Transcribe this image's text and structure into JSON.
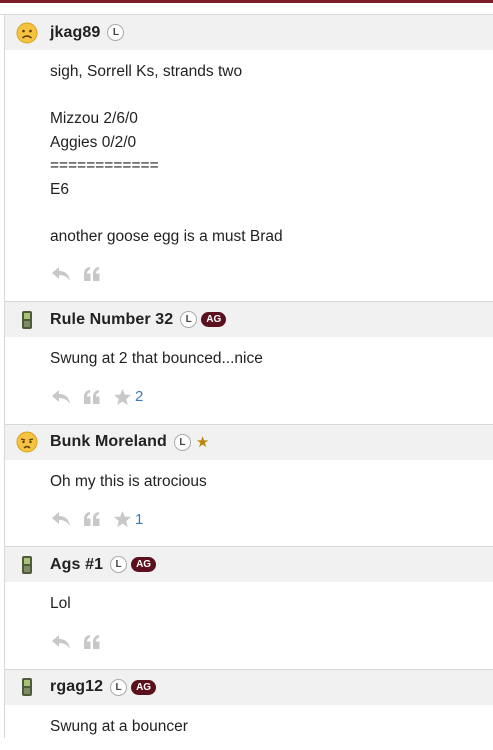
{
  "posts": [
    {
      "username": "jkag89",
      "avatar_icon": "frowning-face-icon",
      "badges": {
        "l": "L"
      },
      "body_lines": [
        "sigh, Sorrell Ks, strands two",
        "",
        "Mizzou 2/6/0",
        "Aggies 0/2/0",
        "============",
        "E6",
        "",
        "another goose egg is a must Brad"
      ],
      "likes": null
    },
    {
      "username": "Rule Number 32",
      "avatar_icon": "phone-icon",
      "badges": {
        "l": "L",
        "ag": "AG"
      },
      "body_lines": [
        "Swung at 2 that bounced...nice"
      ],
      "likes": "2"
    },
    {
      "username": "Bunk Moreland",
      "avatar_icon": "worried-face-icon",
      "badges": {
        "l": "L",
        "star": "★"
      },
      "body_lines": [
        "Oh my this is atrocious"
      ],
      "likes": "1"
    },
    {
      "username": "Ags #1",
      "avatar_icon": "phone-icon",
      "badges": {
        "l": "L",
        "ag": "AG"
      },
      "body_lines": [
        "Lol"
      ],
      "likes": null
    },
    {
      "username": "rgag12",
      "avatar_icon": "phone-icon",
      "badges": {
        "l": "L",
        "ag": "AG"
      },
      "body_lines": [
        "Swung at a bouncer"
      ],
      "likes": null
    }
  ],
  "colors": {
    "accent": "#7a1c2a",
    "ag_badge": "#5c0f1c",
    "like_count": "#3a7ab8",
    "star": "#b8860b"
  }
}
